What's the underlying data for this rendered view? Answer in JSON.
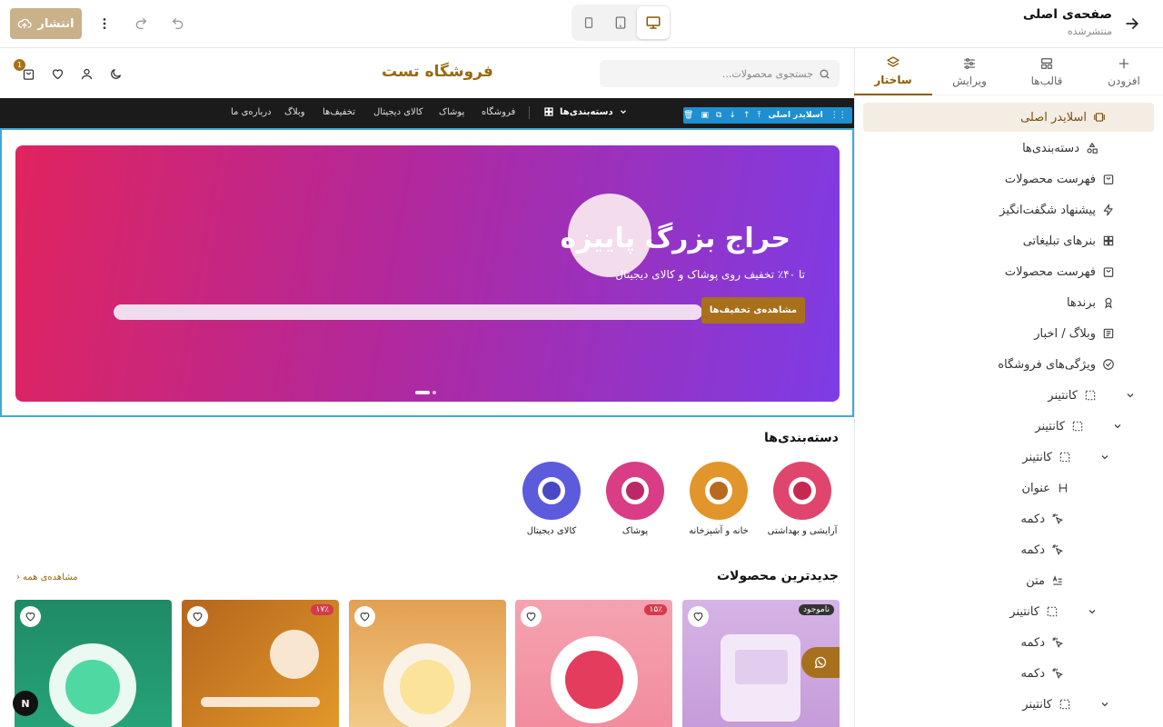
{
  "topbar": {
    "title": "صفحه‌ی اصلی",
    "subtitle": "منتشرشده",
    "publish_label": "انتشار",
    "devices": [
      "mobile",
      "tablet",
      "desktop"
    ],
    "active_device": "desktop"
  },
  "panel": {
    "tabs": [
      {
        "label": "افزودن",
        "icon": "plus-icon"
      },
      {
        "label": "قالب‌ها",
        "icon": "layout-icon"
      },
      {
        "label": "ویرایش",
        "icon": "sliders-icon"
      },
      {
        "label": "ساختار",
        "icon": "layers-icon"
      }
    ],
    "active_tab": "ساختار",
    "tree": [
      {
        "label": "اسلایدر اصلی",
        "icon": "slider-icon",
        "selected": true
      },
      {
        "label": "دسته‌بندی‌ها",
        "icon": "shapes-icon"
      },
      {
        "label": "فهرست محصولات",
        "icon": "bag-icon"
      },
      {
        "label": "پیشنهاد شگفت‌انگیز",
        "icon": "bolt-icon"
      },
      {
        "label": "بنرهای تبلیغاتی",
        "icon": "grid-icon"
      },
      {
        "label": "فهرست محصولات",
        "icon": "bag-icon"
      },
      {
        "label": "برندها",
        "icon": "award-icon"
      },
      {
        "label": "وبلاگ / اخبار",
        "icon": "newspaper-icon"
      },
      {
        "label": "ویژگی‌های فروشگاه",
        "icon": "check-circle-icon"
      },
      {
        "label": "کانتینر",
        "icon": "container-icon",
        "depth": 0,
        "expandable": true
      },
      {
        "label": "کانتینر",
        "icon": "container-icon",
        "depth": 1,
        "expandable": true
      },
      {
        "label": "کانتینر",
        "icon": "container-icon",
        "depth": 2,
        "expandable": true
      },
      {
        "label": "عنوان",
        "icon": "heading-icon",
        "depth": 3
      },
      {
        "label": "دکمه",
        "icon": "click-icon",
        "depth": 3
      },
      {
        "label": "دکمه",
        "icon": "click-icon",
        "depth": 3
      },
      {
        "label": "متن",
        "icon": "text-icon",
        "depth": 3
      },
      {
        "label": "کانتینر",
        "icon": "container-icon",
        "depth": 2,
        "expandable": true
      },
      {
        "label": "دکمه",
        "icon": "click-icon",
        "depth": 3
      },
      {
        "label": "دکمه",
        "icon": "click-icon",
        "depth": 3
      },
      {
        "label": "کانتینر",
        "icon": "container-icon",
        "depth": 2,
        "expandable": true
      }
    ]
  },
  "store": {
    "name": "فروشگاه تست",
    "search_placeholder": "جستجوی محصولات...",
    "cart_count": "1",
    "nav": {
      "categories_label": "دسته‌بندی‌ها",
      "links": [
        "فروشگاه",
        "پوشاک",
        "کالای دیجیتال",
        "تخفیف‌ها",
        "وبلاگ",
        "درباره‌ی ما"
      ]
    },
    "selection_label": "اسلایدر اصلی",
    "hero": {
      "title": "حراج بزرگ پاییزه",
      "subtitle": "تا ۴۰٪ تخفیف روی پوشاک و کالای دیجیتال",
      "button": "مشاهده‌ی تخفیف‌ها"
    },
    "categories_title": "دسته‌بندی‌ها",
    "categories": [
      {
        "label": "آرایشی و بهداشتی",
        "color": "#e0456d"
      },
      {
        "label": "خانه و آشپزخانه",
        "color": "#d9861c"
      },
      {
        "label": "پوشاک",
        "color": "#d83d86"
      },
      {
        "label": "کالای دیجیتال",
        "color": "#5b5bdc"
      }
    ],
    "newest_title": "جدیدترین محصولات",
    "view_all": "مشاهده‌ی همه",
    "products": [
      {
        "badge": "ناموجود",
        "badge_color": "#333333"
      },
      {
        "badge": "۱۵٪",
        "badge_color": "#d33b4a"
      },
      {
        "badge": "",
        "badge_color": ""
      },
      {
        "badge": "۱۷٪",
        "badge_color": "#d33b4a"
      },
      {
        "badge": "",
        "badge_color": ""
      }
    ],
    "widget_label": "N"
  },
  "colors": {
    "accent": "#8b5a00",
    "publish": "#c9b189",
    "selection": "#1e8fd0"
  }
}
